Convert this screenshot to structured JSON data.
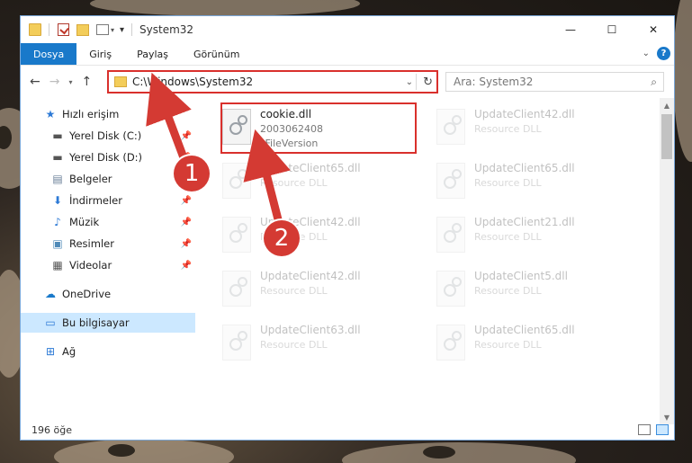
{
  "window": {
    "title": "System32",
    "controls": {
      "minimize": "—",
      "maximize": "☐",
      "close": "✕"
    }
  },
  "ribbon": {
    "tabs": [
      "Dosya",
      "Giriş",
      "Paylaş",
      "Görünüm"
    ],
    "help": "?"
  },
  "navigation": {
    "back": "←",
    "forward": "→",
    "recent": "▾",
    "up": "↑",
    "address": "C:\\Windows\\System32",
    "search_placeholder": "Ara: System32"
  },
  "sidebar": {
    "items": [
      {
        "label": "Hızlı erişim",
        "icon": "star-icon",
        "pinned": false
      },
      {
        "label": "Yerel Disk (C:)",
        "icon": "drive-icon",
        "pinned": true
      },
      {
        "label": "Yerel Disk (D:)",
        "icon": "drive-icon",
        "pinned": true
      },
      {
        "label": "Belgeler",
        "icon": "documents-icon",
        "pinned": true
      },
      {
        "label": "İndirmeler",
        "icon": "download-icon",
        "pinned": true
      },
      {
        "label": "Müzik",
        "icon": "music-icon",
        "pinned": true
      },
      {
        "label": "Resimler",
        "icon": "pictures-icon",
        "pinned": true
      },
      {
        "label": "Videolar",
        "icon": "video-icon",
        "pinned": true
      },
      {
        "label": "OneDrive",
        "icon": "cloud-icon",
        "pinned": false
      },
      {
        "label": "Bu bilgisayar",
        "icon": "computer-icon",
        "pinned": false
      },
      {
        "label": "Ağ",
        "icon": "network-icon",
        "pinned": false
      }
    ]
  },
  "files": [
    {
      "name": "cookie.dll",
      "line2": "2003062408",
      "line3": "*FileVersion",
      "highlighted": true
    },
    {
      "name": "UpdateClient42.dll",
      "line2": "Resource DLL"
    },
    {
      "name": "UpdateClient65.dll",
      "line2": "Resource DLL"
    },
    {
      "name": "UpdateClient65.dll",
      "line2": "Resource DLL"
    },
    {
      "name": "UpdateClient42.dll",
      "line2": "Resource DLL"
    },
    {
      "name": "UpdateClient21.dll",
      "line2": "Resource DLL"
    },
    {
      "name": "UpdateClient42.dll",
      "line2": "Resource DLL"
    },
    {
      "name": "UpdateClient5.dll",
      "line2": "Resource DLL"
    },
    {
      "name": "UpdateClient63.dll",
      "line2": "Resource DLL"
    },
    {
      "name": "UpdateClient65.dll",
      "line2": "Resource DLL"
    }
  ],
  "status": {
    "count": "196 öğe"
  },
  "annotations": {
    "step1": "1",
    "step2": "2"
  },
  "colors": {
    "accent": "#1979ca",
    "highlight": "#d9302c",
    "callout": "#d43a33",
    "selection": "#cce8ff"
  }
}
